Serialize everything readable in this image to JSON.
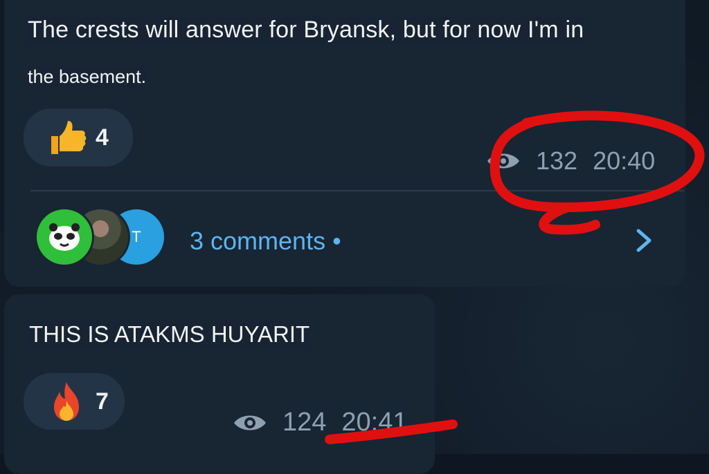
{
  "messages": [
    {
      "text_line1": "The crests will answer for Bryansk, but for now I'm in",
      "text_line2": "the basement.",
      "reaction": {
        "icon": "thumbs-up-icon",
        "count": "4"
      },
      "views": "132",
      "time": "20:40",
      "comments": {
        "label": "3 comments",
        "dot": "•",
        "avatar_letter": "T"
      }
    },
    {
      "text": "THIS IS ATAKMS HUYARIT",
      "reaction": {
        "icon": "fire-icon",
        "count": "7"
      },
      "views": "124",
      "time": "20:41"
    }
  ],
  "colors": {
    "bubble": "#182533",
    "link": "#5fb4f0",
    "meta": "#8fa0b0",
    "annotation": "#e01010"
  }
}
